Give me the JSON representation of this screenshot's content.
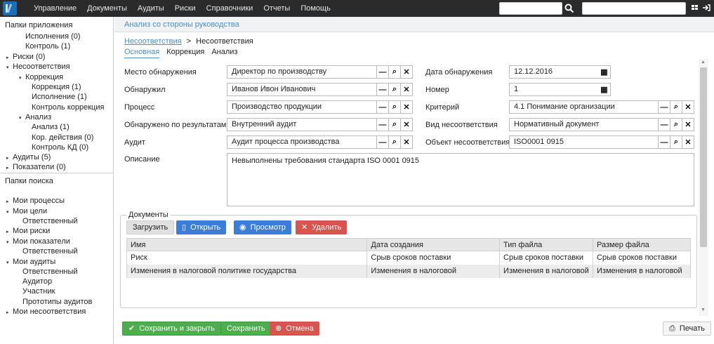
{
  "topbar": {
    "menu": [
      "Управление",
      "Документы",
      "Аудиты",
      "Риски",
      "Справочники",
      "Отчеты",
      "Помощь"
    ],
    "search1_value": "",
    "search2_value": ""
  },
  "sidebar": {
    "app_folders_title": "Папки приложения",
    "app_tree": [
      {
        "label": "Исполнения (0)",
        "arrow": ""
      },
      {
        "label": "Контроль (1)",
        "arrow": ""
      },
      {
        "label": "Риски (0)",
        "arrow": "▸"
      },
      {
        "label": "Несоответствия",
        "arrow": "▾"
      },
      {
        "label": "Коррекция",
        "arrow": "▾"
      },
      {
        "label": "Коррекция (1)",
        "arrow": ""
      },
      {
        "label": "Исполнение (1)",
        "arrow": ""
      },
      {
        "label": "Контроль коррекция",
        "arrow": ""
      },
      {
        "label": "Анализ",
        "arrow": "▾"
      },
      {
        "label": "Анализ (1)",
        "arrow": ""
      },
      {
        "label": "Кор. действия (0)",
        "arrow": ""
      },
      {
        "label": "Контроль КД (0)",
        "arrow": ""
      },
      {
        "label": "Аудиты (5)",
        "arrow": "▸"
      },
      {
        "label": "Показатели (0)",
        "arrow": "▸"
      }
    ],
    "search_folders_title": "Папки поиска",
    "search_tree": [
      {
        "label": "Мои процессы",
        "arrow": "▸"
      },
      {
        "label": "Мои цели",
        "arrow": "▾"
      },
      {
        "label": "Ответственный",
        "arrow": ""
      },
      {
        "label": "Мои риски",
        "arrow": "▸"
      },
      {
        "label": "Мои показатели",
        "arrow": "▾"
      },
      {
        "label": "Ответственный",
        "arrow": ""
      },
      {
        "label": "Мои аудиты",
        "arrow": "▾"
      },
      {
        "label": "Ответственный",
        "arrow": ""
      },
      {
        "label": "Аудитор",
        "arrow": ""
      },
      {
        "label": "Участник",
        "arrow": ""
      },
      {
        "label": "Прототипы аудитов",
        "arrow": ""
      },
      {
        "label": "Мои несоответствия",
        "arrow": "▸"
      }
    ]
  },
  "main": {
    "header_title": "Анализ со стороны руководства",
    "breadcrumb": {
      "link": "Несоответствия",
      "separator": ">",
      "current": "Несоответствия"
    },
    "tabs": [
      "Основная",
      "Коррекция",
      "Анализ"
    ],
    "form": {
      "place_label": "Место обнаружения",
      "place_value": "Директор по производству",
      "found_by_label": "Обнаружил",
      "found_by_value": "Иванов Ивон Иванович",
      "process_label": "Процесс",
      "process_value": "Производство продукции",
      "found_result_label": "Обнаружено по результатам",
      "found_result_value": "Внутренний аудит",
      "audit_label": "Аудит",
      "audit_value": "Аудит процесса производства",
      "date_label": "Дата обнаружения",
      "date_value": "12.12.2016",
      "number_label": "Номер",
      "number_value": "1",
      "criterion_label": "Критерий",
      "criterion_value": "4.1 Понимание организации",
      "type_label": "Вид несоответствия",
      "type_value": "Нормативный документ",
      "object_label": "Объект несоответствия",
      "object_value": "ISO0001 0915",
      "description_label": "Описание",
      "description_value": "Невыполнены требования стандарта ISO 0001 0915"
    },
    "documents": {
      "legend": "Документы",
      "upload_label": "Загрузить",
      "open_label": "Открыть",
      "view_label": "Просмотр",
      "delete_label": "Удалить",
      "columns": [
        "Имя",
        "Дата создания",
        "Тип файла",
        "Размер файла"
      ],
      "rows": [
        [
          "Риск",
          "Срыв сроков поставки",
          "Срыв сроков поставки",
          "Срыв сроков поставки"
        ],
        [
          "Изменения в налоговой политике государства",
          "Изменения в налоговой",
          "Изменения в налоговой",
          "Изменения в налоговой"
        ]
      ]
    },
    "footer": {
      "save_close_label": "Сохранить и закрыть",
      "save_label": "Сохранить",
      "cancel_label": "Отмена",
      "print_label": "Печать"
    }
  }
}
